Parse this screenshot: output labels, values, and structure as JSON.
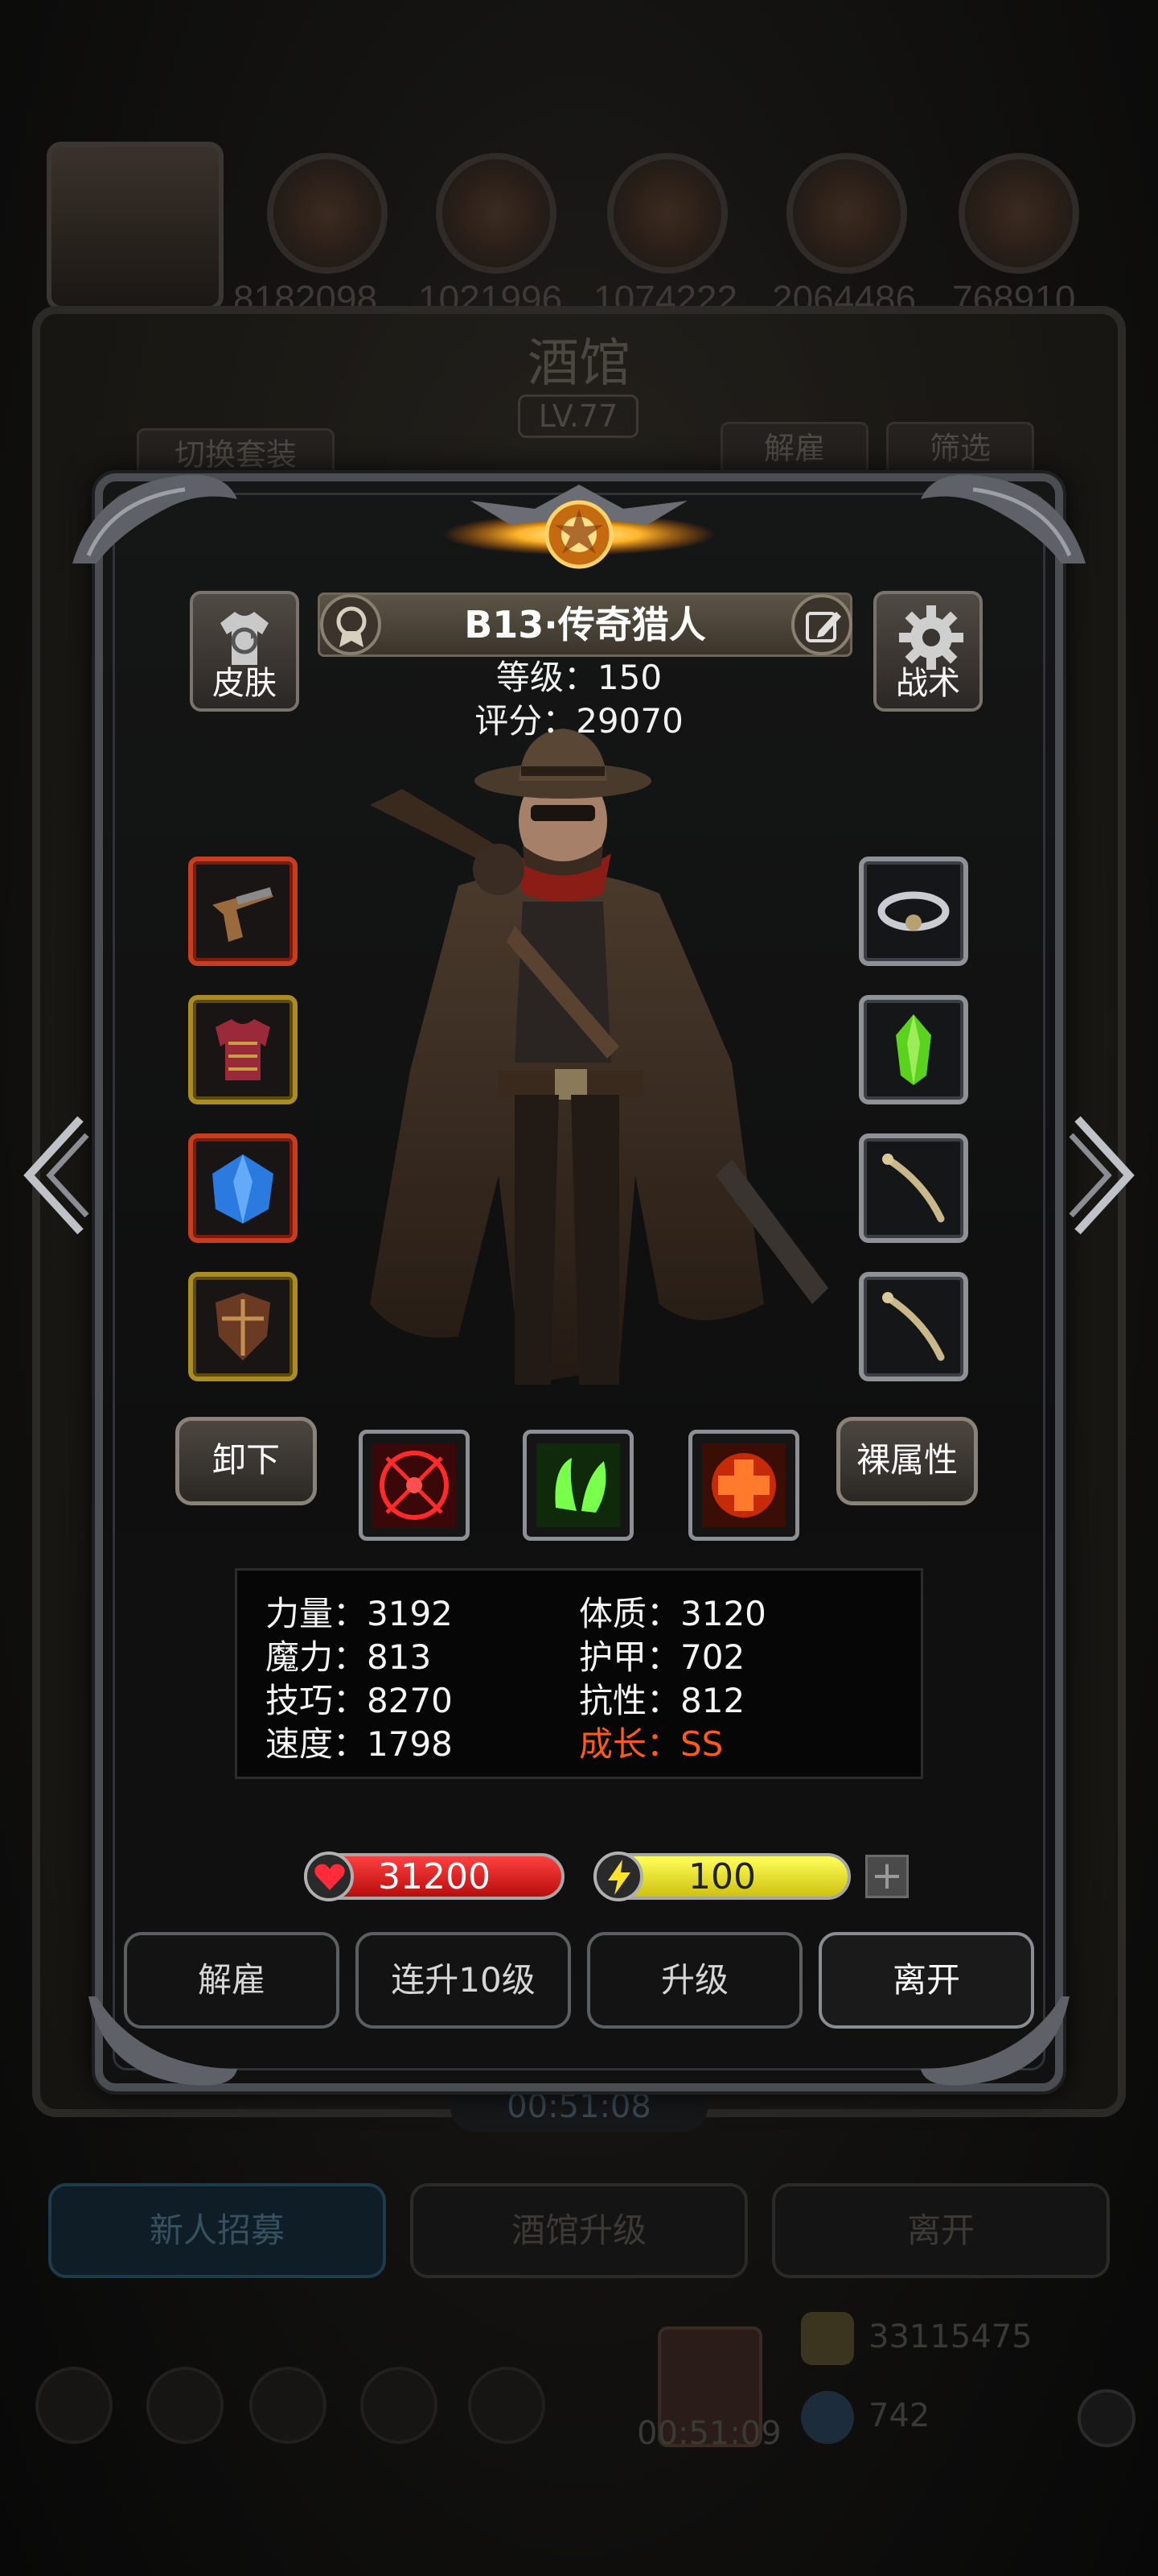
{
  "background": {
    "tavern_title": "酒馆",
    "tavern_level": "LV.77",
    "top_numbers": [
      "8182098",
      "1021996",
      "1074222",
      "2064486",
      "768910"
    ],
    "switch_outfit_label": "切换套装",
    "dismiss_label": "解雇",
    "filter_label": "筛选",
    "timer": "00:51:08",
    "tabs": [
      "新人招募",
      "酒馆升级",
      "离开"
    ],
    "gold": "33115475",
    "gems": "742",
    "dock_timer": "00:51:09"
  },
  "hero": {
    "name": "B13·传奇猎人",
    "level_line": "等级：150",
    "score_line": "评分：29070",
    "skin_label": "皮肤",
    "tactics_label": "战术"
  },
  "controls": {
    "unequip_label": "卸下",
    "base_attr_label": "裸属性"
  },
  "stats": {
    "strength": "力量：3192",
    "magic": "魔力：813",
    "skill": "技巧：8270",
    "speed": "速度：1798",
    "constitution": "体质：3120",
    "armor": "护甲：702",
    "resistance": "抗性：812",
    "growth": "成长：SS"
  },
  "bars": {
    "hp": "31200",
    "energy": "100",
    "plus": "+"
  },
  "actions": {
    "dismiss": "解雇",
    "level_up_10": "连升10级",
    "level_up": "升级",
    "leave": "离开"
  },
  "colors": {
    "growth": "#ff5a1e",
    "hp_bar": "#d81c1c",
    "energy_bar": "#e8dc1e",
    "slot_red": "#c63e1e",
    "slot_gold": "#a98d24"
  },
  "icons": {
    "left_slots": [
      "flintlock-pistol-icon",
      "red-armor-icon",
      "blue-gem-icon",
      "wooden-shield-icon"
    ],
    "right_slots": [
      "storm-ring-icon",
      "green-crystal-icon",
      "bone-charm-icon",
      "bone-charm-icon"
    ],
    "skills": [
      "red-target-icon",
      "green-claw-icon",
      "red-cross-icon"
    ]
  }
}
